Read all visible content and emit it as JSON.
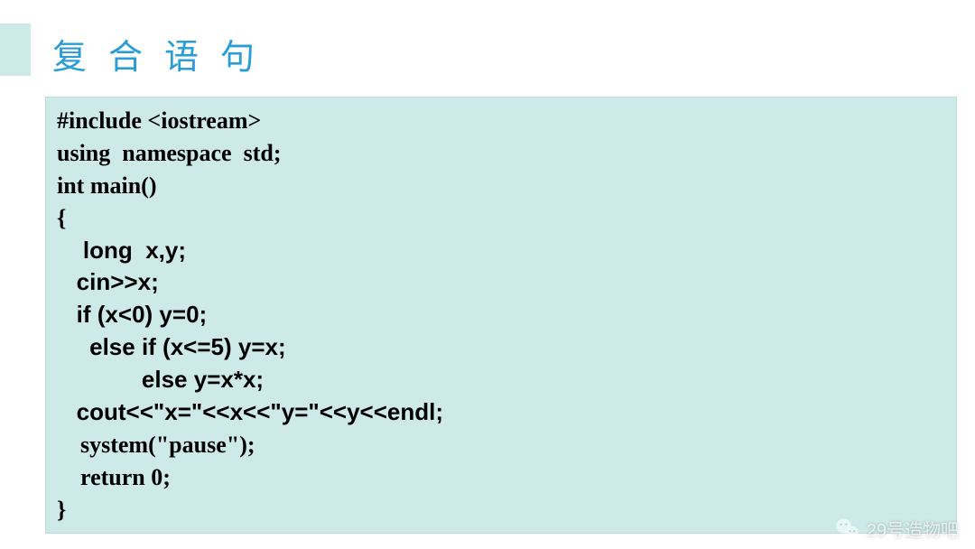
{
  "title": "复合语句",
  "code": {
    "l1": "#include <iostream>",
    "l2": "using  namespace  std;",
    "l3": "int main()",
    "l4": "{",
    "l5": "    long  x,y;",
    "l6": "   cin>>x;",
    "l7": "   if (x<0) y=0;",
    "l8": "     else if (x<=5) y=x;",
    "l9": "             else y=x*x;",
    "l10": "   cout<<\"x=\"<<x<<\"y=\"<<y<<endl;",
    "l11": "    system(\"pause\");",
    "l12": "    return 0;",
    "l13": "}"
  },
  "watermark": "29号造物吧"
}
